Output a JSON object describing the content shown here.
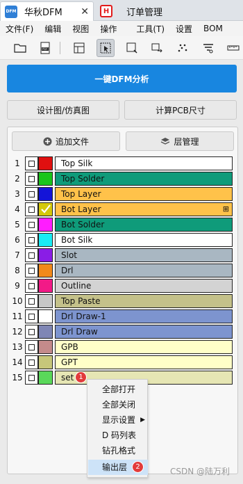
{
  "tabs": [
    {
      "logo": "DFM",
      "label": "华秋DFM",
      "close": "✕"
    },
    {
      "logo": "H",
      "label": "订单管理"
    }
  ],
  "menu": [
    "文件(F)",
    "编辑",
    "视图",
    "操作",
    "工具(T)",
    "设置",
    "BOM"
  ],
  "toolbar_icons": [
    "open-folder-icon",
    "pdf-icon",
    "layout-icon",
    "select-cursor-icon",
    "zoom-box-icon",
    "move-icon",
    "scatter-icon",
    "filter-icon",
    "ruler-icon"
  ],
  "main_button": "一键DFM分析",
  "sub_buttons": {
    "design_view": "设计图/仿真图",
    "calc_pcb": "计算PCB尺寸"
  },
  "panel_buttons": {
    "add_file": "追加文件",
    "layer_manage": "层管理"
  },
  "layers": [
    {
      "num": "1",
      "name": "Top Silk",
      "color": "#e01010",
      "bg": "#ffffff",
      "checked": false
    },
    {
      "num": "2",
      "name": "Top Solder",
      "color": "#19c51b",
      "bg": "#0f9b7a",
      "checked": false
    },
    {
      "num": "3",
      "name": "Top Layer",
      "color": "#1414d8",
      "bg": "#ffc24a",
      "checked": false
    },
    {
      "num": "4",
      "name": "Bot Layer",
      "color": "#d4c90a",
      "bg": "#ffc24a",
      "checked": true,
      "expand": "⊞"
    },
    {
      "num": "5",
      "name": "Bot Solder",
      "color": "#ff1dff",
      "bg": "#0f9b7a",
      "checked": false
    },
    {
      "num": "6",
      "name": "Bot Silk",
      "color": "#19ecf5",
      "bg": "#ffffff",
      "checked": false
    },
    {
      "num": "7",
      "name": "Slot",
      "color": "#8a1de6",
      "bg": "#a9b7c2",
      "checked": false
    },
    {
      "num": "8",
      "name": "Drl",
      "color": "#f2891a",
      "bg": "#a9b7c2",
      "checked": false
    },
    {
      "num": "9",
      "name": "Outline",
      "color": "#f21a87",
      "bg": "#d3d3d3",
      "checked": false
    },
    {
      "num": "10",
      "name": "Top Paste",
      "color": "#c7c7c7",
      "bg": "#c4c18a",
      "checked": false
    },
    {
      "num": "11",
      "name": "Drl Draw-1",
      "color": "#ffffff",
      "bg": "#7d94cf",
      "checked": false
    },
    {
      "num": "12",
      "name": "Drl Draw",
      "color": "#7f86b5",
      "bg": "#7d94cf",
      "checked": false
    },
    {
      "num": "13",
      "name": "GPB",
      "color": "#c48b8b",
      "bg": "#ffffc8",
      "checked": false
    },
    {
      "num": "14",
      "name": "GPT",
      "color": "#c7c77a",
      "bg": "#ffffc8",
      "checked": false
    },
    {
      "num": "15",
      "name": "set",
      "color": "#5ad85a",
      "bg": "#e6e6b4",
      "checked": false
    }
  ],
  "context_menu": [
    {
      "label": "全部打开"
    },
    {
      "label": "全部关闭"
    },
    {
      "label": "显示设置",
      "submenu": "▶"
    },
    {
      "label": "D 码列表"
    },
    {
      "label": "钻孔格式"
    },
    {
      "label": "输出层",
      "highlight": true
    }
  ],
  "badges": [
    "1",
    "2"
  ],
  "watermark": "CSDN @陆万利"
}
